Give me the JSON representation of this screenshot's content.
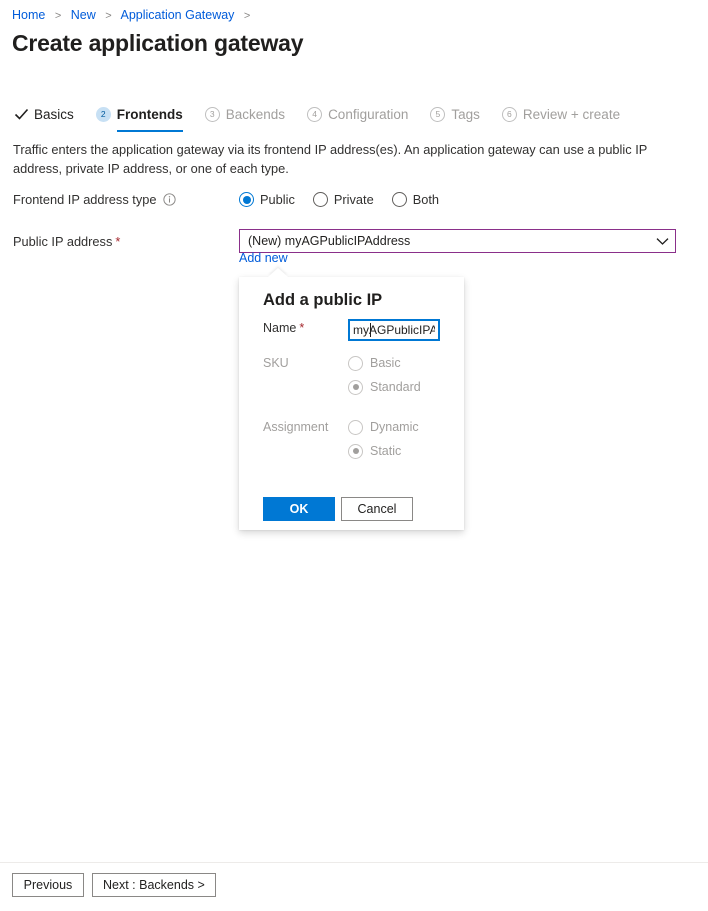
{
  "breadcrumb": {
    "items": [
      {
        "label": "Home"
      },
      {
        "label": "New"
      },
      {
        "label": "Application Gateway"
      }
    ],
    "separator": ">"
  },
  "page": {
    "title": "Create application gateway"
  },
  "steps": [
    {
      "badge": "✓",
      "label": "Basics",
      "state": "complete"
    },
    {
      "badge": "2",
      "label": "Frontends",
      "state": "active"
    },
    {
      "badge": "3",
      "label": "Backends",
      "state": "disabled"
    },
    {
      "badge": "4",
      "label": "Configuration",
      "state": "disabled"
    },
    {
      "badge": "5",
      "label": "Tags",
      "state": "disabled"
    },
    {
      "badge": "6",
      "label": "Review + create",
      "state": "disabled"
    }
  ],
  "intro": "Traffic enters the application gateway via its frontend IP address(es). An application gateway can use a public IP address, private IP address, or one of each type.",
  "form": {
    "ip_type": {
      "label": "Frontend IP address type",
      "info_icon": "info-icon",
      "options": [
        {
          "label": "Public",
          "selected": true
        },
        {
          "label": "Private",
          "selected": false
        },
        {
          "label": "Both",
          "selected": false
        }
      ]
    },
    "public_ip": {
      "label": "Public IP address",
      "required_marker": "*",
      "value": "(New) myAGPublicIPAddress",
      "chevron_icon": "chevron-down-icon",
      "add_new_label": "Add new"
    }
  },
  "dialog": {
    "title": "Add a public IP",
    "name": {
      "label": "Name",
      "required_marker": "*",
      "value": "myAGPublicIPAddress"
    },
    "sku": {
      "label": "SKU",
      "options": [
        {
          "label": "Basic",
          "selected": false
        },
        {
          "label": "Standard",
          "selected": true
        }
      ]
    },
    "assignment": {
      "label": "Assignment",
      "options": [
        {
          "label": "Dynamic",
          "selected": false
        },
        {
          "label": "Static",
          "selected": true
        }
      ]
    },
    "ok_label": "OK",
    "cancel_label": "Cancel"
  },
  "footer": {
    "previous_label": "Previous",
    "next_label": "Next : Backends >"
  },
  "colors": {
    "accent": "#0078d4",
    "link": "#015cda",
    "required": "#a4262c",
    "dropdown_border": "#8a2f8a",
    "disabled_text": "#a19f9d"
  }
}
